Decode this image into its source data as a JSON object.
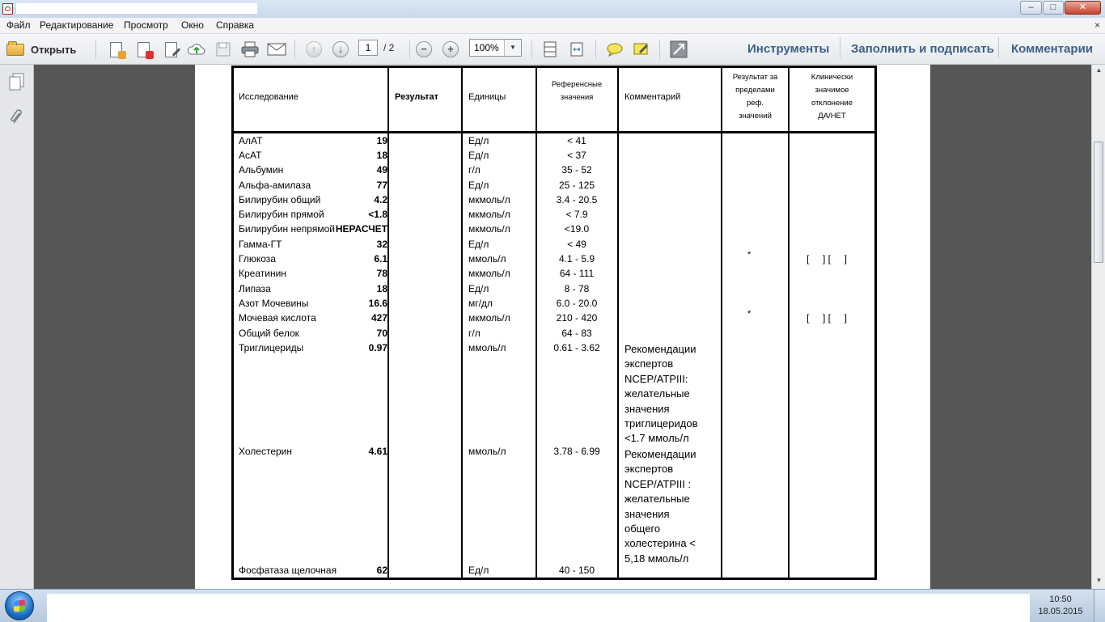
{
  "window": {
    "title": "",
    "controls": {
      "minimize": "–",
      "maximize": "□",
      "close": "✕"
    }
  },
  "menu": {
    "items": [
      "Файл",
      "Редактирование",
      "Просмотр",
      "Окно",
      "Справка"
    ],
    "close_doc": "×"
  },
  "toolbar": {
    "open_label": "Открыть",
    "page_current": "1",
    "page_total": "/ 2",
    "zoom": "100%",
    "tools_label": "Инструменты",
    "fill_sign_label": "Заполнить и подписать",
    "comments_label": "Комментарии"
  },
  "table": {
    "headers": {
      "study": "Исследование",
      "result": "Результат",
      "units": "Единицы",
      "reference": [
        "Референсные",
        "значения"
      ],
      "comment": "Комментарий",
      "out_of_range": [
        "Результат за",
        "пределами",
        "реф.",
        "значений"
      ],
      "clinical": [
        "Клинически",
        "значимое",
        "отклонение",
        "ДА/НЕТ"
      ]
    },
    "rows": [
      {
        "name": "АлАТ",
        "result": "19",
        "units": "Ед/л",
        "ref": "< 41"
      },
      {
        "name": "АсАТ",
        "result": "18",
        "units": "Ед/л",
        "ref": "< 37"
      },
      {
        "name": "Альбумин",
        "result": "49",
        "units": "г/л",
        "ref": "35 - 52"
      },
      {
        "name": "Альфа-амилаза",
        "result": "77",
        "units": "Ед/л",
        "ref": "25 - 125"
      },
      {
        "name": "Билирубин общий",
        "result": "4.2",
        "units": "мкмоль/л",
        "ref": "3.4 - 20.5"
      },
      {
        "name": "Билирубин прямой",
        "result": "<1.8",
        "units": "мкмоль/л",
        "ref": "< 7.9"
      },
      {
        "name": "Билирубин непрямой",
        "result": "НЕРАСЧЕТ",
        "units": "мкмоль/л",
        "ref": "<19.0"
      },
      {
        "name": "Гамма-ГТ",
        "result": "32",
        "units": "Ед/л",
        "ref": "< 49"
      },
      {
        "name": "Глюкоза",
        "result": "6.1",
        "units": "ммоль/л",
        "ref": "4.1 - 5.9",
        "flag": "*",
        "clinical": "[     ] [     ]"
      },
      {
        "name": "Креатинин",
        "result": "78",
        "units": "мкмоль/л",
        "ref": "64 - 111"
      },
      {
        "name": "Липаза",
        "result": "18",
        "units": "Ед/л",
        "ref": "8 - 78"
      },
      {
        "name": "Азот Мочевины",
        "result": "16.6",
        "units": "мг/дл",
        "ref": "6.0 - 20.0"
      },
      {
        "name": "Мочевая кислота",
        "result": "427",
        "units": "мкмоль/л",
        "ref": "210 - 420",
        "flag": "*",
        "clinical": "[     ] [     ]"
      },
      {
        "name": "Общий белок",
        "result": "70",
        "units": "г/л",
        "ref": "64 - 83"
      },
      {
        "name": "Триглицериды",
        "result": "0.97",
        "units": "ммоль/л",
        "ref": "0.61 - 3.62"
      },
      {
        "name": "Холестерин",
        "result": "4.61",
        "units": "ммоль/л",
        "ref": "3.78 - 6.99"
      },
      {
        "name": "Фосфатаза щелочная",
        "result": "62",
        "units": "Ед/л",
        "ref": "40 - 150"
      }
    ],
    "comments": {
      "triglycerides": [
        "Рекомендации",
        "экспертов",
        "NCEP/ATPIII:",
        "желательные",
        "значения",
        "триглицеридов",
        "<1.7 ммоль/л"
      ],
      "cholesterol": [
        "Рекомендации",
        "экспертов",
        "NCEP/ATPIII :",
        "желательные",
        "значения",
        "общего",
        "холестерина <",
        "5,18 ммоль/л"
      ]
    }
  },
  "taskbar": {
    "time": "10:50",
    "date": "18.05.2015"
  }
}
